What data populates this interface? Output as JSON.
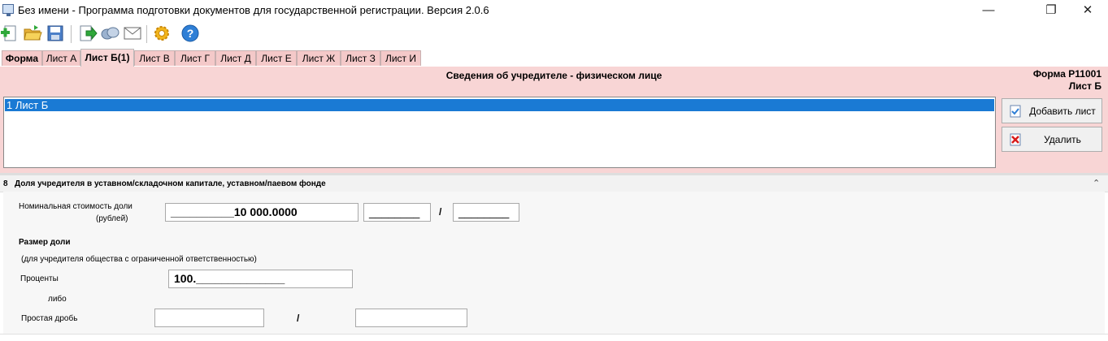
{
  "window": {
    "title": "Без имени - Программа подготовки документов для государственной регистрации. Версия 2.0.6",
    "controls": {
      "minimize": "—",
      "maximize": "❐",
      "close": "✕"
    }
  },
  "toolbar": {
    "icons": [
      "new-document-icon",
      "open-folder-icon",
      "save-icon",
      "export-icon",
      "print-icon",
      "mail-icon",
      "settings-icon",
      "help-icon"
    ]
  },
  "tabs": [
    {
      "label": "Форма"
    },
    {
      "label": "Лист А"
    },
    {
      "label": "Лист Б(1)"
    },
    {
      "label": "Лист В"
    },
    {
      "label": "Лист Г"
    },
    {
      "label": "Лист Д"
    },
    {
      "label": "Лист Е"
    },
    {
      "label": "Лист Ж"
    },
    {
      "label": "Лист З"
    },
    {
      "label": "Лист И"
    }
  ],
  "panel": {
    "title": "Сведения об учредителе - физическом лице",
    "form_code_line1": "Форма Р11001",
    "form_code_line2": "Лист Б",
    "list_items": [
      "1 Лист Б"
    ],
    "add_label": "Добавить лист",
    "delete_label": "Удалить"
  },
  "section": {
    "number": "8",
    "title": "Доля учредителя в уставном/складочном капитале, уставном/паевом фонде",
    "nominal_label_1": "Номинальная стоимость доли",
    "nominal_label_2": "(рублей)",
    "nominal_value": "__________10 000.0000",
    "nominal_part2": "________",
    "nominal_slash": "/",
    "nominal_part3": "________",
    "share_size_label": "Размер доли",
    "share_note": "(для учредителя общества с ограниченной ответственностью)",
    "percent_label": "Проценты",
    "percent_value": "100.______________",
    "or_label": "либо",
    "fraction_label": "Простая дробь",
    "fraction_numerator": "",
    "fraction_slash": "/",
    "fraction_denominator": ""
  },
  "colors": {
    "panel_bg": "#f8d5d5",
    "tab_bg": "#f4c9c9",
    "selection": "#1a7ad4"
  }
}
